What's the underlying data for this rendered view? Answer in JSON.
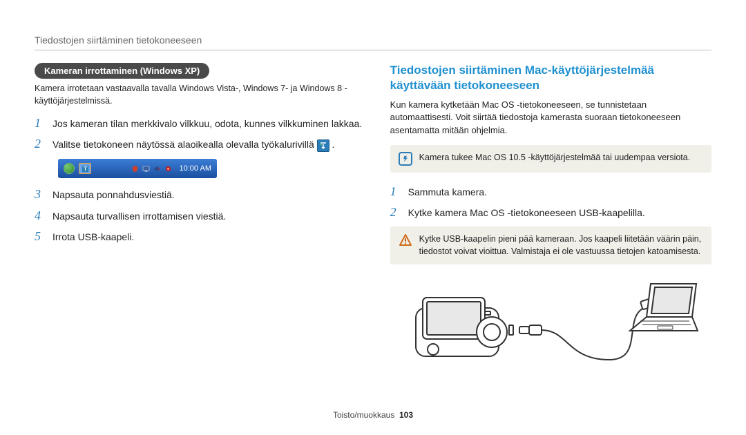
{
  "breadcrumb": "Tiedostojen siirtäminen tietokoneeseen",
  "left": {
    "pill": "Kameran irrottaminen (Windows XP)",
    "intro": "Kamera irrotetaan vastaavalla tavalla Windows Vista-, Windows 7- ja Windows 8 -käyttöjärjestelmissä.",
    "steps": [
      {
        "n": "1",
        "text": "Jos kameran tilan merkkivalo vilkkuu, odota, kunnes vilkkuminen lakkaa."
      },
      {
        "n": "2",
        "text_pre": "Valitse tietokoneen näytössä alaoikealla olevalla työkalurivillä ",
        "has_icon": true,
        "text_post": " ."
      },
      {
        "n": "3",
        "text": "Napsauta ponnahdusviestiä."
      },
      {
        "n": "4",
        "text": "Napsauta turvallisen irrottamisen viestiä."
      },
      {
        "n": "5",
        "text": "Irrota USB-kaapeli."
      }
    ],
    "taskbar_clock": "10:00 AM"
  },
  "right": {
    "title": "Tiedostojen siirtäminen Mac-käyttöjärjestelmää käyttävään tietokoneeseen",
    "intro": "Kun kamera kytketään Mac OS -tietokoneeseen, se tunnistetaan automaattisesti. Voit siirtää tiedostoja kamerasta suoraan tietokoneeseen asentamatta mitään ohjelmia.",
    "info_note": "Kamera tukee Mac OS 10.5 -käyttöjärjestelmää tai uudempaa versiota.",
    "steps": [
      {
        "n": "1",
        "text": "Sammuta kamera."
      },
      {
        "n": "2",
        "text": "Kytke kamera Mac OS -tietokoneeseen USB-kaapelilla."
      }
    ],
    "warn_note": "Kytke USB-kaapelin pieni pää kameraan. Jos kaapeli liitetään väärin päin, tiedostot voivat vioittua. Valmistaja ei ole vastuussa tietojen katoamisesta."
  },
  "footer": {
    "label": "Toisto/muokkaus",
    "page": "103"
  }
}
